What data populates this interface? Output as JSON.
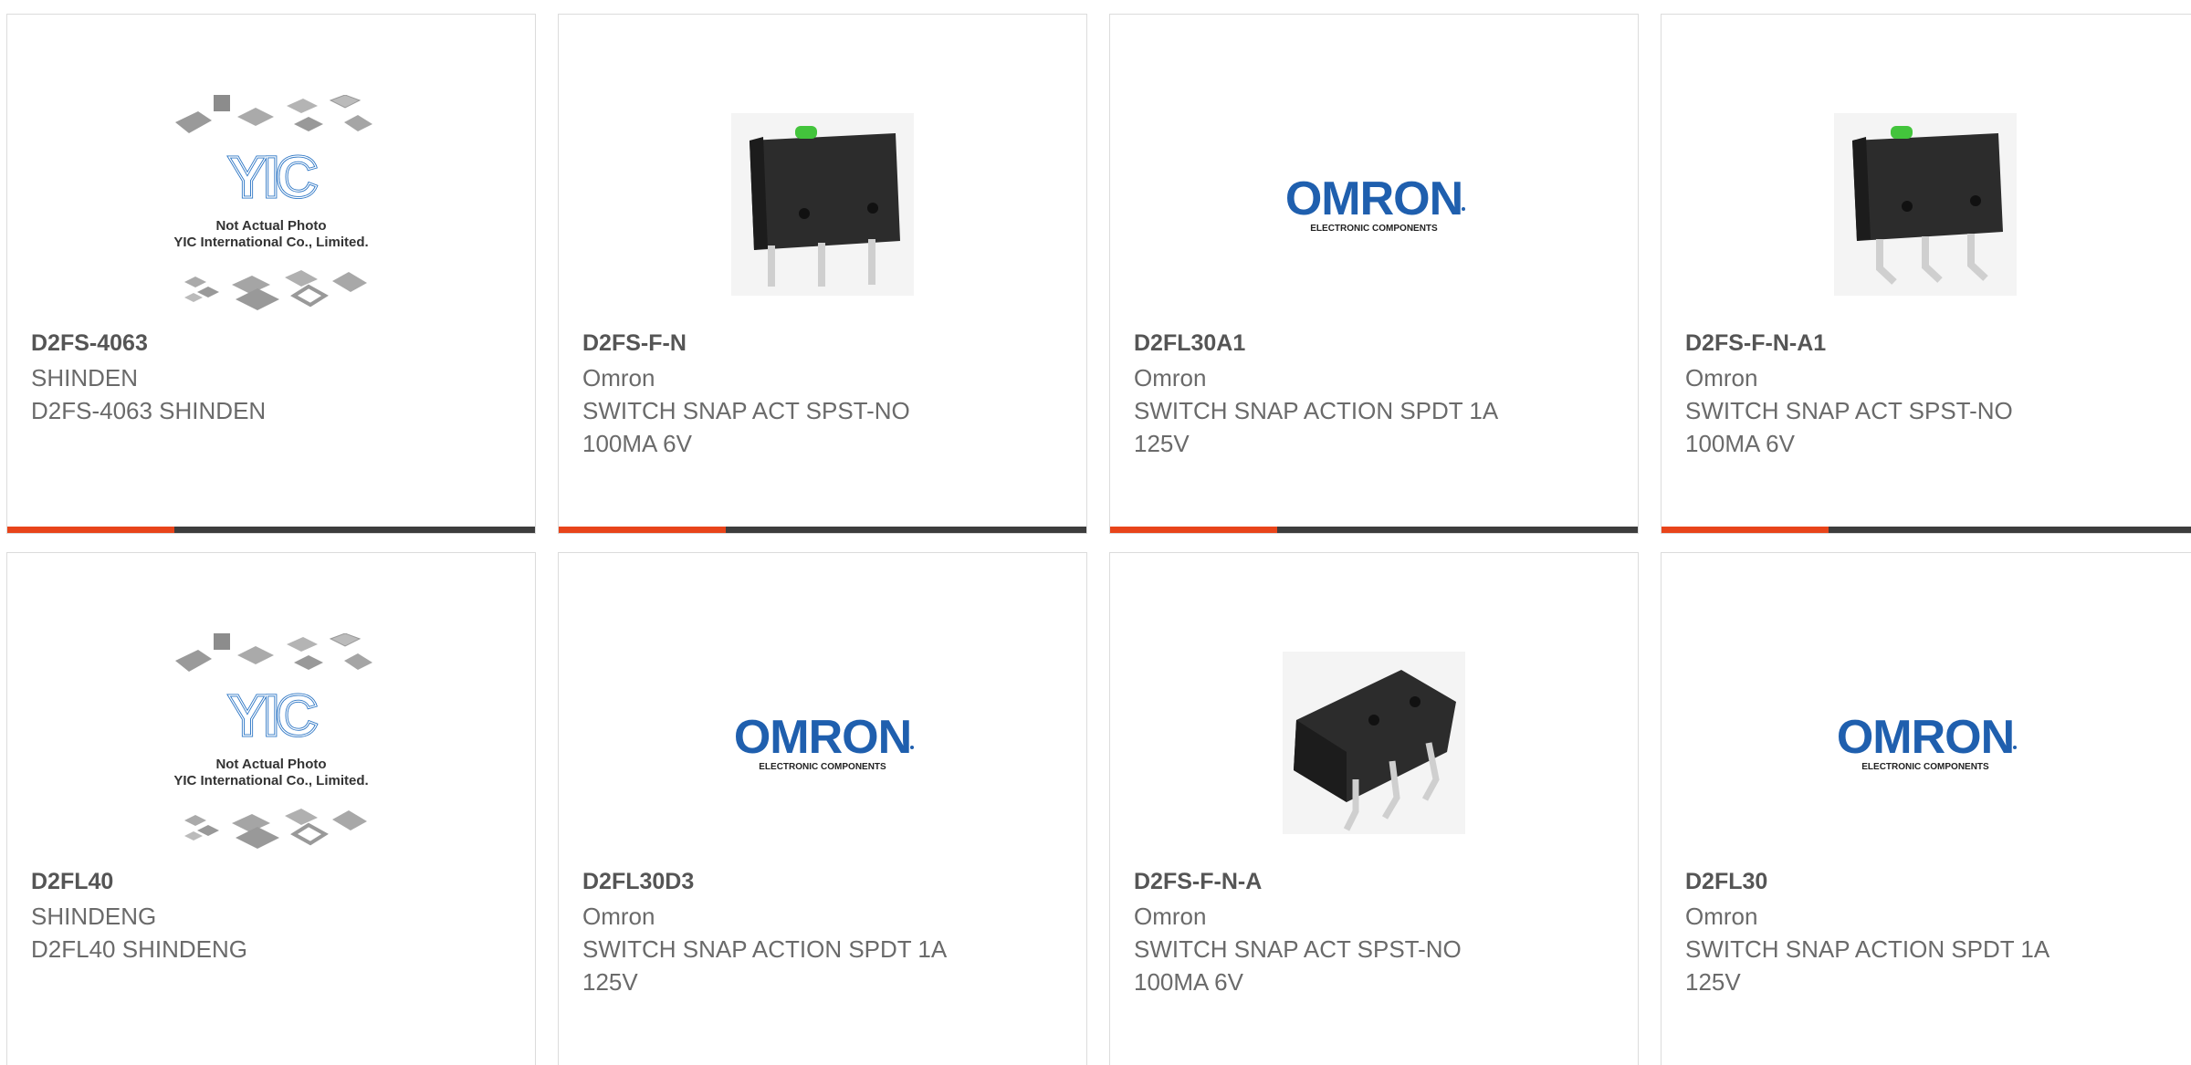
{
  "colors": {
    "accent": "#e8441a",
    "bar": "#3d3d3d",
    "omron_blue": "#1f5fae",
    "yic_blue": "#2a74c4"
  },
  "placeholder_image": {
    "logo_text": "YIC",
    "caption_line1": "Not Actual Photo",
    "caption_line2": "YIC International Co., Limited."
  },
  "omron_logo": {
    "brand": "OMRON",
    "tagline": "ELECTRONIC COMPONENTS"
  },
  "products": [
    {
      "part_number": "D2FS-4063",
      "manufacturer": "SHINDEN",
      "description": "D2FS-4063 SHINDEN",
      "image": "yic-placeholder"
    },
    {
      "part_number": "D2FS-F-N",
      "manufacturer": "Omron",
      "description": "SWITCH SNAP ACT SPST-NO 100MA 6V",
      "image": "microswitch-photo"
    },
    {
      "part_number": "D2FL30A1",
      "manufacturer": "Omron",
      "description": "SWITCH SNAP ACTION SPDT 1A 125V",
      "image": "omron-logo"
    },
    {
      "part_number": "D2FS-F-N-A1",
      "manufacturer": "Omron",
      "description": "SWITCH SNAP ACT SPST-NO 100MA 6V",
      "image": "microswitch-photo-bent"
    },
    {
      "part_number": "D2FL40",
      "manufacturer": "SHINDENG",
      "description": "D2FL40 SHINDENG",
      "image": "yic-placeholder"
    },
    {
      "part_number": "D2FL30D3",
      "manufacturer": "Omron",
      "description": "SWITCH SNAP ACTION SPDT 1A 125V",
      "image": "omron-logo"
    },
    {
      "part_number": "D2FS-F-N-A",
      "manufacturer": "Omron",
      "description": "SWITCH SNAP ACT SPST-NO 100MA 6V",
      "image": "microswitch-photo-angled"
    },
    {
      "part_number": "D2FL30",
      "manufacturer": "Omron",
      "description": "SWITCH SNAP ACTION SPDT 1A 125V",
      "image": "omron-logo"
    }
  ]
}
